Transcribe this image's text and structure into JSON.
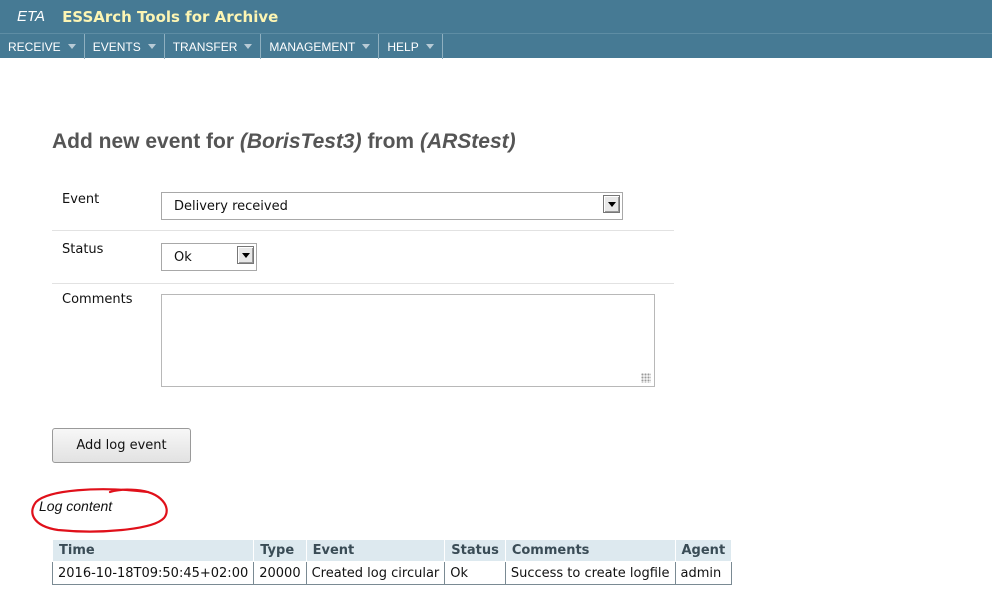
{
  "header": {
    "short_name": "ETA",
    "title": "ESSArch Tools for Archive"
  },
  "nav": {
    "items": [
      {
        "label": "RECEIVE"
      },
      {
        "label": "EVENTS"
      },
      {
        "label": "TRANSFER"
      },
      {
        "label": "MANAGEMENT"
      },
      {
        "label": "HELP"
      }
    ]
  },
  "page": {
    "title_prefix": "Add new event for ",
    "title_ip": "(BorisTest3)",
    "title_from": " from ",
    "title_source": "(ARStest)"
  },
  "form": {
    "event_label": "Event",
    "event_value": "Delivery received",
    "status_label": "Status",
    "status_value": "Ok",
    "comments_label": "Comments",
    "comments_value": "",
    "add_button": "Add log event"
  },
  "log": {
    "heading": "Log content",
    "columns": [
      "Time",
      "Type",
      "Event",
      "Status",
      "Comments",
      "Agent"
    ],
    "rows": [
      [
        "2016-10-18T09:50:45+02:00",
        "20000",
        "Created log circular",
        "Ok",
        "Success to create logfile",
        "admin"
      ]
    ]
  },
  "colors": {
    "header_bg": "#467a94",
    "brand_title": "#fdf5b3",
    "annotation": "#e0101a"
  }
}
